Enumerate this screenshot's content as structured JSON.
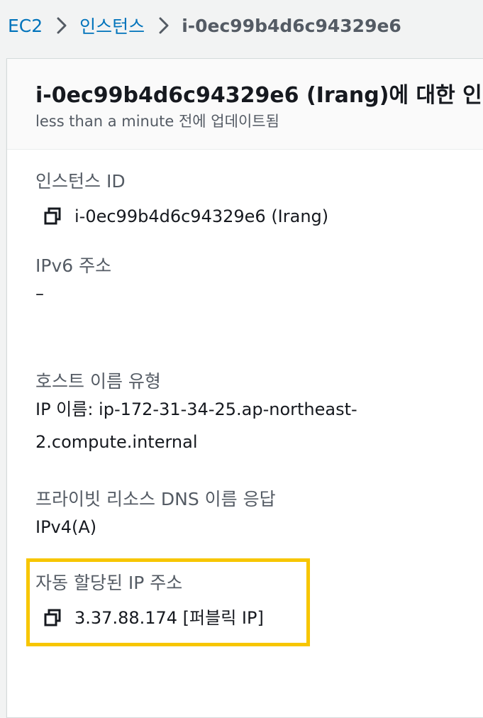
{
  "breadcrumb": {
    "items": [
      "EC2",
      "인스턴스"
    ],
    "current": "i-0ec99b4d6c94329e6"
  },
  "panel": {
    "title": "i-0ec99b4d6c94329e6 (Irang)에 대한 인",
    "subtitle": "less than a minute 전에 업데이트됨"
  },
  "fields": {
    "instance_id": {
      "label": "인스턴스 ID",
      "value": "i-0ec99b4d6c94329e6 (Irang)"
    },
    "ipv6": {
      "label": "IPv6 주소",
      "value": "–"
    },
    "hostname_type": {
      "label": "호스트 이름 유형",
      "value_line1": "IP 이름: ip-172-31-34-25.ap-northeast-",
      "value_line2": "2.compute.internal"
    },
    "private_dns": {
      "label": "프라이빗 리소스 DNS 이름 응답",
      "value": "IPv4(A)"
    },
    "auto_ip": {
      "label": "자동 할당된 IP 주소",
      "value": "3.37.88.174 [퍼블릭 IP]"
    }
  },
  "icons": {
    "copy": "copy-icon",
    "separator": "chevron-right-icon"
  },
  "colors": {
    "link": "#0073bb",
    "highlight": "#f7c600",
    "label": "#545b64"
  }
}
